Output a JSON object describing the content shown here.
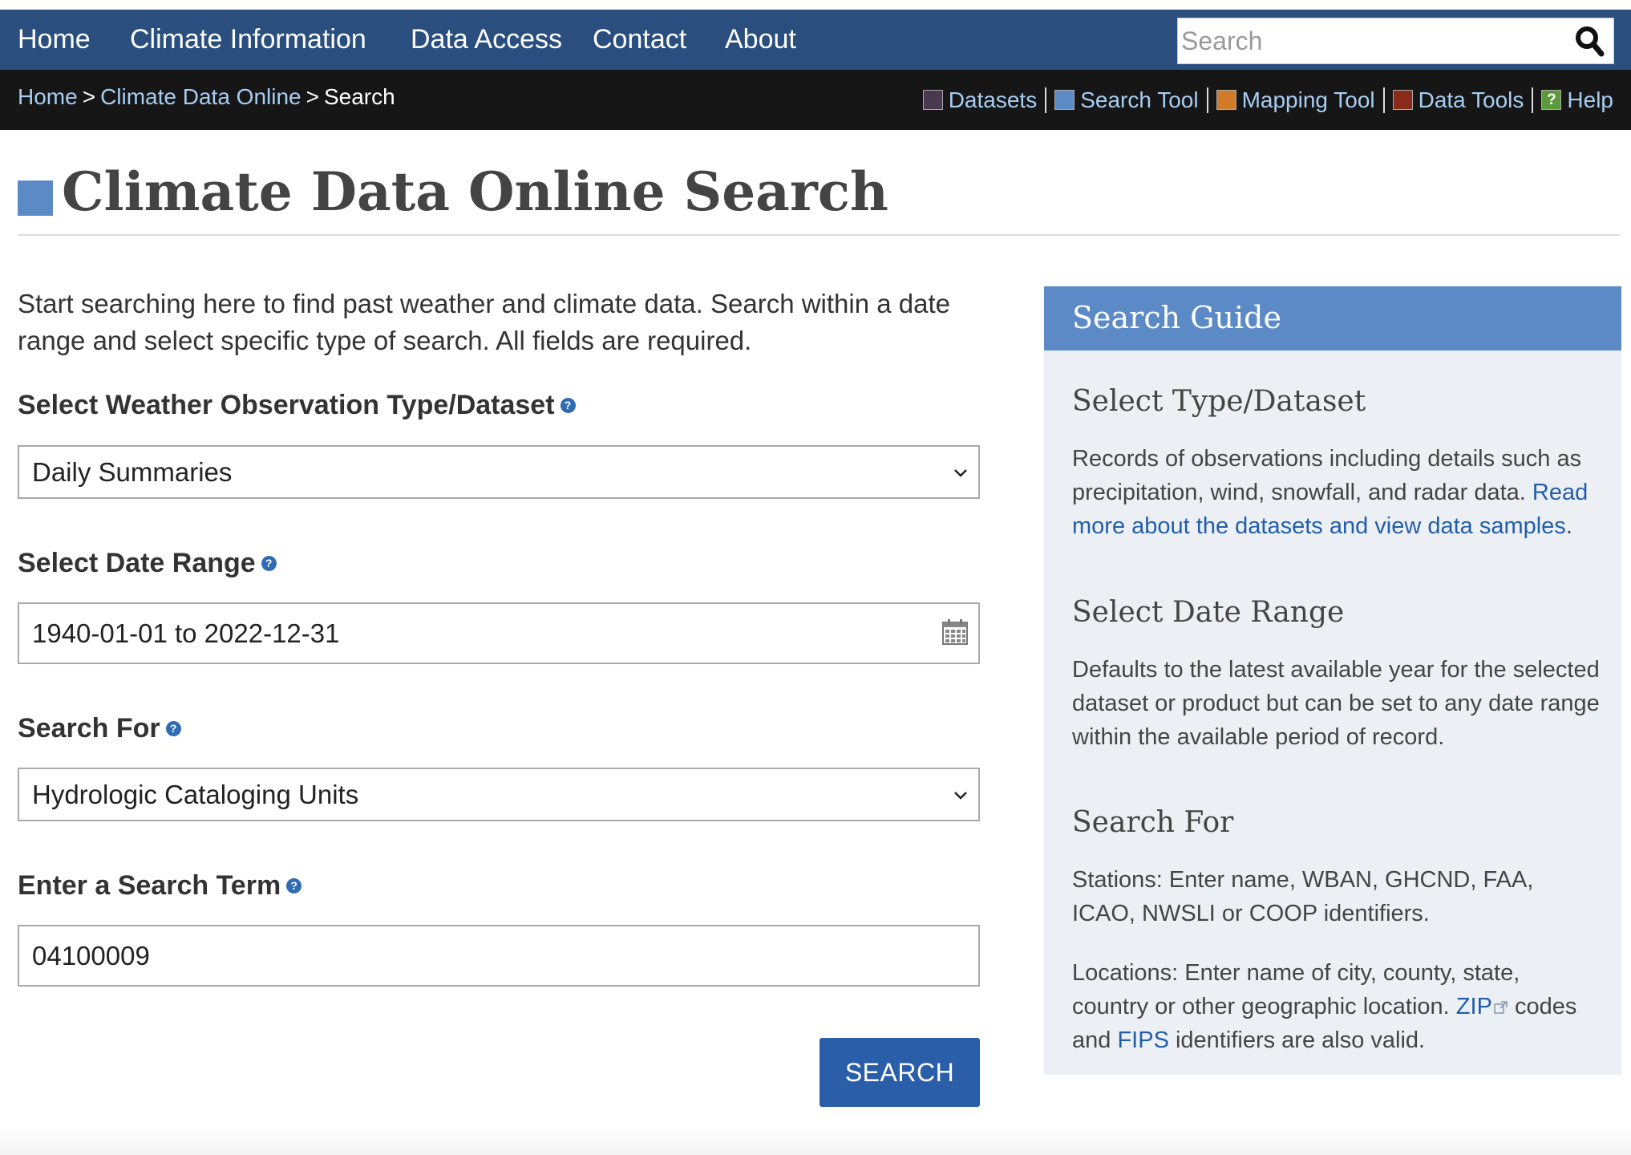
{
  "nav": {
    "items": [
      "Home",
      "Climate Information",
      "Data Access",
      "Contact",
      "About"
    ],
    "search_placeholder": "Search"
  },
  "breadcrumb": {
    "home": "Home",
    "sep1": ">",
    "section": "Climate Data Online",
    "sep2": ">",
    "current": "Search"
  },
  "tools": [
    {
      "label": "Datasets",
      "color": "#4a3850"
    },
    {
      "label": "Search Tool",
      "color": "#5b8ac6"
    },
    {
      "label": "Mapping Tool",
      "color": "#d07a2a"
    },
    {
      "label": "Data Tools",
      "color": "#8a2a1a"
    },
    {
      "label": "Help",
      "color": "#5a9a3a",
      "glyph": "?"
    }
  ],
  "page": {
    "title": "Climate Data Online Search",
    "intro": "Start searching here to find past weather and climate data. Search within a date range and select specific type of search. All fields are required."
  },
  "form": {
    "dataset_label": "Select Weather Observation Type/Dataset",
    "dataset_value": "Daily Summaries",
    "date_label": "Select Date Range",
    "date_value": "1940-01-01 to 2022-12-31",
    "search_for_label": "Search For",
    "search_for_value": "Hydrologic Cataloging Units",
    "term_label": "Enter a Search Term",
    "term_value": "04100009",
    "help_glyph": "?",
    "submit_label": "SEARCH"
  },
  "guide": {
    "title": "Search Guide",
    "type_heading": "Select Type/Dataset",
    "type_text": "Records of observations including details such as precipitation, wind, snowfall, and radar data.",
    "type_link": "Read more about the datasets and view data samples",
    "type_link_end": ".",
    "date_heading": "Select Date Range",
    "date_text": "Defaults to the latest available year for the selected dataset or product but can be set to any date range within the available period of record.",
    "search_heading": "Search For",
    "stations_text": "Stations: Enter name, WBAN, GHCND, FAA, ICAO, NWSLI or COOP identifiers.",
    "locations_text": "Locations: Enter name of city, county, state, country or other geographic location.",
    "zip_link": "ZIP",
    "codes_and": "codes and",
    "fips_link": "FIPS",
    "identifiers_text": "identifiers are also valid."
  }
}
